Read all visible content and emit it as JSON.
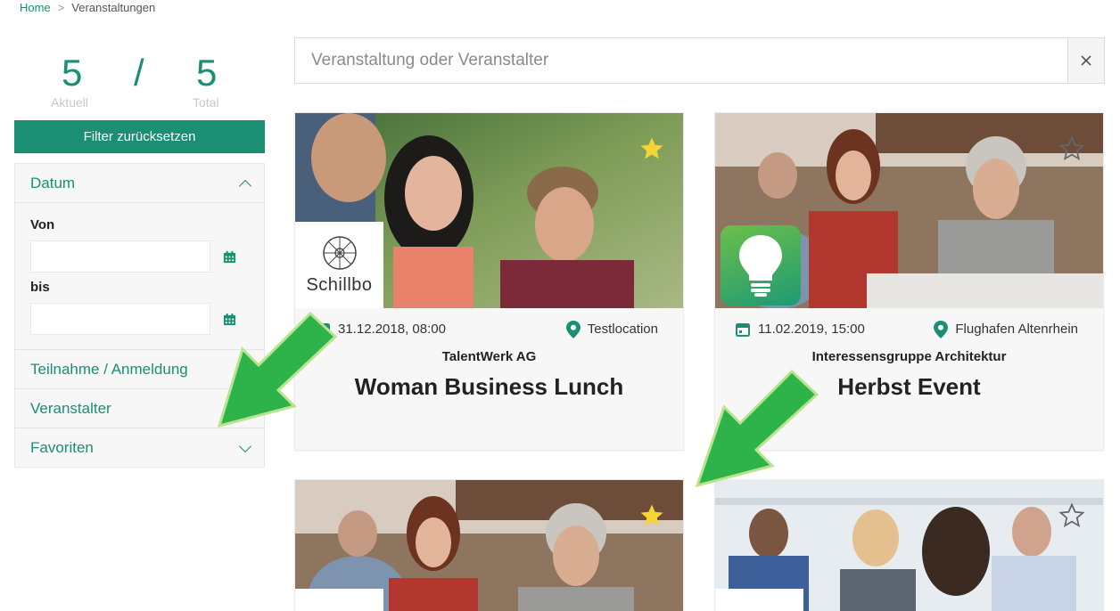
{
  "breadcrumb": {
    "home": "Home",
    "separator": ">",
    "current": "Veranstaltungen"
  },
  "counter": {
    "current": "5",
    "separator": "/",
    "total": "5",
    "current_label": "Aktuell",
    "total_label": "Total"
  },
  "reset_button": "Filter zurücksetzen",
  "filters": {
    "datum": {
      "label": "Datum",
      "von_label": "Von",
      "von_value": "",
      "bis_label": "bis",
      "bis_value": ""
    },
    "teilnahme": {
      "label": "Teilnahme / Anmeldung"
    },
    "veranstalter": {
      "label": "Veranstalter"
    },
    "favoriten": {
      "label": "Favoriten"
    }
  },
  "search": {
    "placeholder": "Veranstaltung oder Veranstalter",
    "value": ""
  },
  "events": [
    {
      "date": "31.12.2018, 08:00",
      "location": "Testlocation",
      "organizer": "TalentWerk AG",
      "title": "Woman Business Lunch",
      "favorite": true,
      "logo_text": "Schillbo"
    },
    {
      "date": "11.02.2019, 15:00",
      "location": "Flughafen Altenrhein",
      "organizer": "Interessensgruppe Architektur",
      "title": "Herbst Event",
      "favorite": false
    },
    {
      "favorite": true
    },
    {
      "favorite": false
    }
  ],
  "colors": {
    "accent": "#1a8f73",
    "star_active": "#f4d533",
    "arrow": "#2db34a"
  },
  "icons": [
    "calendar-icon",
    "map-pin-icon",
    "star-icon",
    "close-icon",
    "chevron-up-icon",
    "chevron-down-icon",
    "lightbulb-icon"
  ]
}
